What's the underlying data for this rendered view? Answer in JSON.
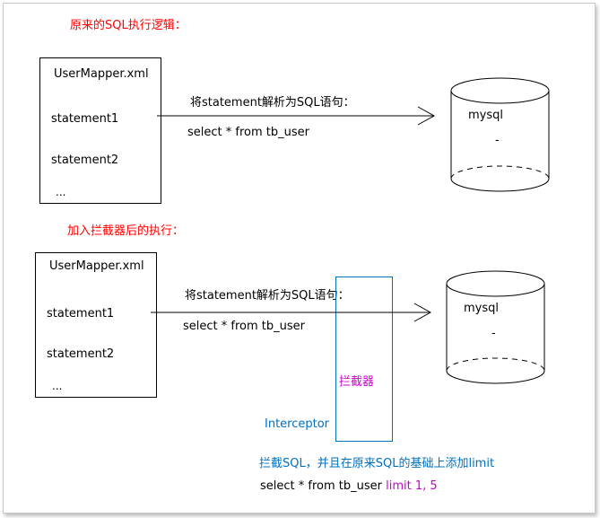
{
  "diagram": {
    "top": {
      "title": "原来的SQL执行逻辑：",
      "mapper": {
        "title": "UserMapper.xml",
        "items": [
          "statement1",
          "statement2",
          "..."
        ]
      },
      "arrow_label": "将statement解析为SQL语句：",
      "sql": "select * from tb_user",
      "db": {
        "name": "mysql",
        "dash": "-"
      }
    },
    "bottom": {
      "title": "加入拦截器后的执行：",
      "mapper": {
        "title": "UserMapper.xml",
        "items": [
          "statement1",
          "statement2",
          "..."
        ]
      },
      "arrow_label": "将statement解析为SQL语句：",
      "sql": "select * from tb_user",
      "db": {
        "name": "mysql",
        "dash": "-"
      },
      "interceptor_cn": "拦截器",
      "interceptor_en": "Interceptor",
      "note": "拦截SQL，并且在原来SQL的基础上添加limit",
      "sql_prefix": "select * from tb_user",
      "sql_limit": "limit 1, 5"
    }
  },
  "colors": {
    "title": "#ff0000",
    "interceptor": "#0070c0",
    "highlight": "#cc00cc"
  }
}
